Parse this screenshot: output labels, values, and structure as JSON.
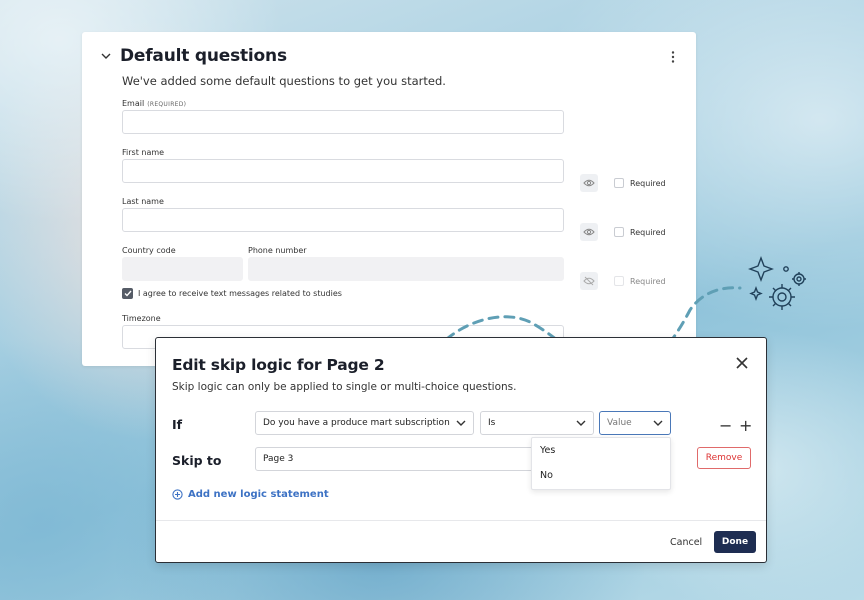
{
  "card": {
    "title": "Default questions",
    "subtitle": "We've added some default questions to get you started.",
    "fields": {
      "email_label": "Email",
      "email_required_tag": "(REQUIRED)",
      "first_name_label": "First name",
      "last_name_label": "Last name",
      "country_code_label": "Country code",
      "phone_label": "Phone number",
      "timezone_label": "Timezone"
    },
    "required_label": "Required",
    "sms_consent": "I agree to receive text messages related to studies"
  },
  "modal": {
    "title": "Edit skip logic for Page 2",
    "subtitle": "Skip logic can only be applied to single or multi-choice questions.",
    "if_label": "If",
    "question_select": "Do you have a produce mart subscription",
    "operator_select": "Is",
    "value_placeholder": "Value",
    "value_options": [
      "Yes",
      "No"
    ],
    "skip_to_label": "Skip to",
    "skip_to_value": "Page 3",
    "remove_label": "Remove",
    "add_statement": "Add new logic statement",
    "minus": "−",
    "plus": "+",
    "cancel_label": "Cancel",
    "done_label": "Done"
  },
  "colors": {
    "accent_navy": "#1e2d52",
    "link_blue": "#3d72c4",
    "remove_red": "#d33333",
    "dash_teal": "#5f9fb5"
  },
  "icons": [
    "chevron-down-icon",
    "kebab-menu-icon",
    "eye-icon",
    "eye-off-icon",
    "checkmark-icon",
    "close-icon",
    "plus-circle-icon",
    "sparkle-icon",
    "gear-icon"
  ]
}
